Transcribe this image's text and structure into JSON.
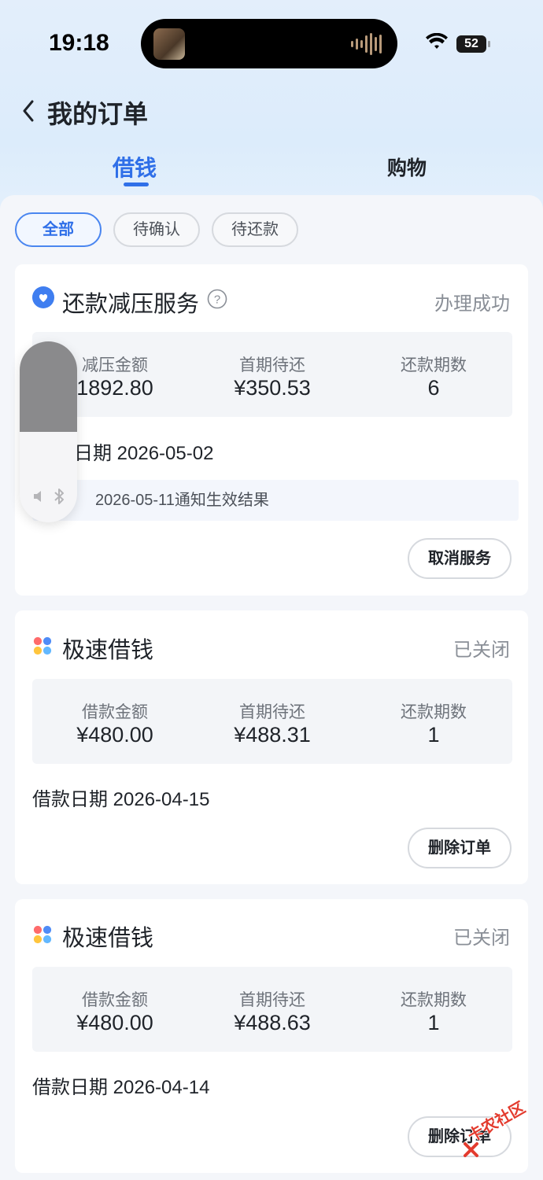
{
  "status_bar": {
    "time": "19:18",
    "battery": "52",
    "icons": [
      "now-playing-icon",
      "audio-wave-icon",
      "wifi-icon",
      "battery-icon"
    ]
  },
  "header": {
    "title": "我的订单",
    "back_icon": "chevron-left-icon",
    "tabs": [
      {
        "label": "借钱",
        "active": true
      },
      {
        "label": "购物",
        "active": false
      }
    ]
  },
  "filters": [
    {
      "label": "全部",
      "active": true
    },
    {
      "label": "待确认",
      "active": false
    },
    {
      "label": "待还款",
      "active": false
    }
  ],
  "colors": {
    "accent": "#2f6fe8",
    "status_text": "#8a8f97",
    "background": "#f4f6fa"
  },
  "orders": [
    {
      "icon": "shield-heart-icon",
      "title": "还款减压服务",
      "help_icon": "question-icon",
      "status": "办理成功",
      "columns": [
        {
          "label": "减压金额",
          "value": "1892.80"
        },
        {
          "label": "首期待还",
          "value": "¥350.53"
        },
        {
          "label": "还款期数",
          "value": "6"
        }
      ],
      "date": "日期 2026-05-02",
      "notice": "2026-05-11通知生效结果",
      "action": "取消服务"
    },
    {
      "icon": "four-dots-icon",
      "title": "极速借钱",
      "status": "已关闭",
      "columns": [
        {
          "label": "借款金额",
          "value": "¥480.00"
        },
        {
          "label": "首期待还",
          "value": "¥488.31"
        },
        {
          "label": "还款期数",
          "value": "1"
        }
      ],
      "date": "借款日期 2026-04-15",
      "action": "删除订单"
    },
    {
      "icon": "four-dots-icon",
      "title": "极速借钱",
      "status": "已关闭",
      "columns": [
        {
          "label": "借款金额",
          "value": "¥480.00"
        },
        {
          "label": "首期待还",
          "value": "¥488.63"
        },
        {
          "label": "还款期数",
          "value": "1"
        }
      ],
      "date": "借款日期 2026-04-14",
      "action": "删除订单"
    }
  ],
  "volume_hud": {
    "level": 0.5,
    "icons": [
      "speaker-muted-icon",
      "bluetooth-icon"
    ]
  },
  "watermark": "卡农社区"
}
